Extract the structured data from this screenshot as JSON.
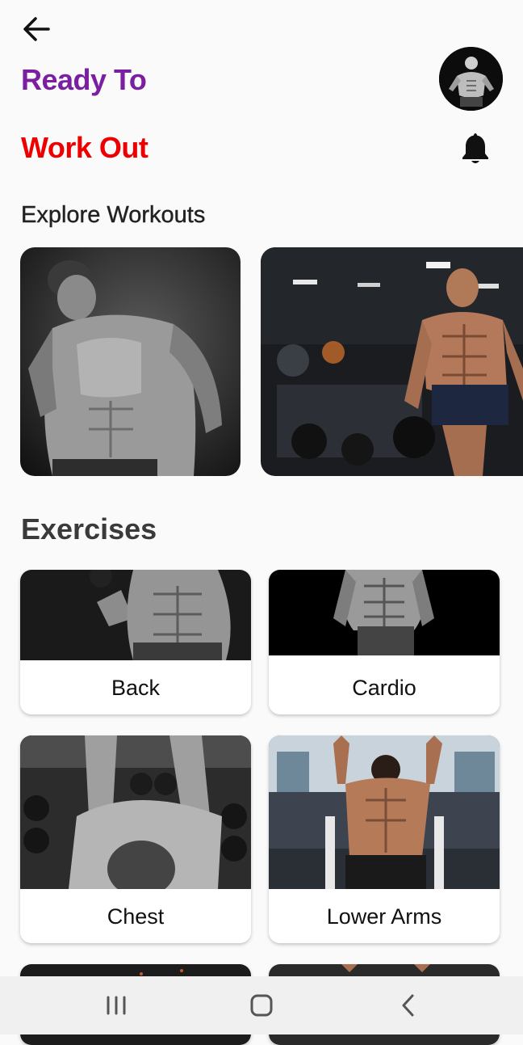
{
  "header": {
    "back_icon": "arrow-left-icon",
    "title_line1": "Ready To",
    "title_line2": "Work Out",
    "title_line1_color": "#7b1fa2",
    "title_line2_color": "#ee0000",
    "notification_icon": "bell-icon"
  },
  "explore": {
    "title": "Explore Workouts"
  },
  "exercises": {
    "title": "Exercises",
    "items": [
      {
        "label": "Back"
      },
      {
        "label": "Cardio"
      },
      {
        "label": "Chest"
      },
      {
        "label": "Lower Arms"
      }
    ]
  },
  "system_nav": {
    "recents_icon": "recents-icon",
    "home_icon": "home-icon",
    "back_icon": "chevron-left-icon"
  }
}
